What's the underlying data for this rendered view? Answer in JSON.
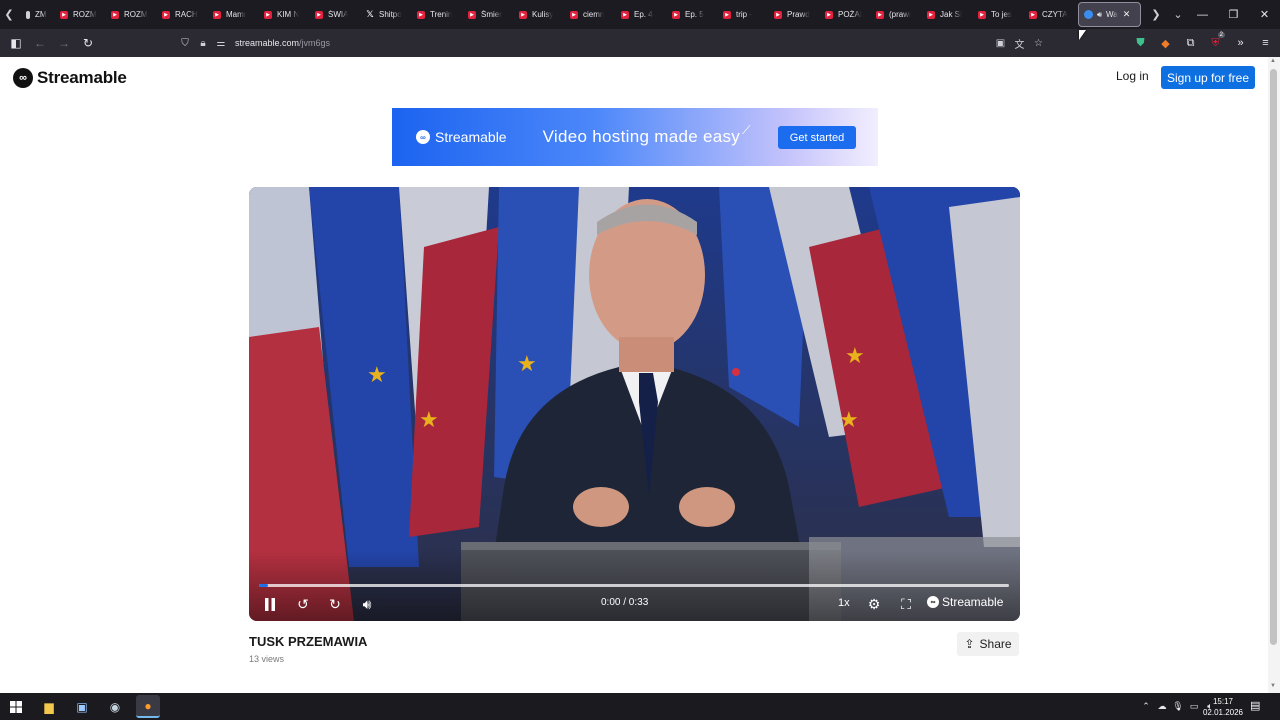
{
  "browser": {
    "tabs": [
      {
        "title": "ZM",
        "favicon": "tab-favicon-icon"
      },
      {
        "title": "ROZM",
        "favicon": "youtube-icon"
      },
      {
        "title": "ROZM",
        "favicon": "youtube-icon"
      },
      {
        "title": "RACH",
        "favicon": "youtube-icon"
      },
      {
        "title": "Mamr",
        "favicon": "youtube-icon"
      },
      {
        "title": "KIM N",
        "favicon": "youtube-icon"
      },
      {
        "title": "ŚWIĄ",
        "favicon": "youtube-icon"
      },
      {
        "title": "Shitpo",
        "favicon": "x-icon"
      },
      {
        "title": "Trenin",
        "favicon": "youtube-icon"
      },
      {
        "title": "Śmier",
        "favicon": "youtube-icon"
      },
      {
        "title": "Kulisy",
        "favicon": "youtube-icon"
      },
      {
        "title": "ciemn",
        "favicon": "youtube-icon"
      },
      {
        "title": "Ep. 4",
        "favicon": "youtube-icon"
      },
      {
        "title": "Ep. 5",
        "favicon": "youtube-icon"
      },
      {
        "title": "trip -",
        "favicon": "youtube-icon"
      },
      {
        "title": "Prawd",
        "favicon": "youtube-icon"
      },
      {
        "title": "POŻAI",
        "favicon": "youtube-icon"
      },
      {
        "title": "(prawi",
        "favicon": "youtube-icon"
      },
      {
        "title": "Jak SI",
        "favicon": "youtube-icon"
      },
      {
        "title": "To jes",
        "favicon": "youtube-icon"
      },
      {
        "title": "CZYTA",
        "favicon": "youtube-icon"
      }
    ],
    "active_tab": {
      "title": "Wa",
      "favicon": "streamable-icon"
    },
    "url_host": "streamable.com",
    "url_path": "/jvm6gs",
    "extension_badge": "2"
  },
  "site": {
    "logo_text": "Streamable",
    "login_label": "Log in",
    "signup_label": "Sign up for free"
  },
  "banner": {
    "logo_text": "Streamable",
    "headline": "Video hosting made easy",
    "cta_label": "Get started"
  },
  "player": {
    "time_current": "0:00",
    "time_total": "0:33",
    "time_display": "0:00 / 0:33",
    "speed": "1x",
    "brand": "Streamable",
    "progress_fraction": 0.012,
    "accent_color": "#1f6fe8"
  },
  "video": {
    "title": "TUSK PRZEMAWIA",
    "views": "13 views",
    "share_label": "Share"
  },
  "taskbar": {
    "time": "15:17",
    "date": "02.01.2026"
  },
  "colors": {
    "brand_blue": "#0d6fe0",
    "tab_bar": "#1c1b22",
    "nav_bar": "#2b2a33"
  }
}
